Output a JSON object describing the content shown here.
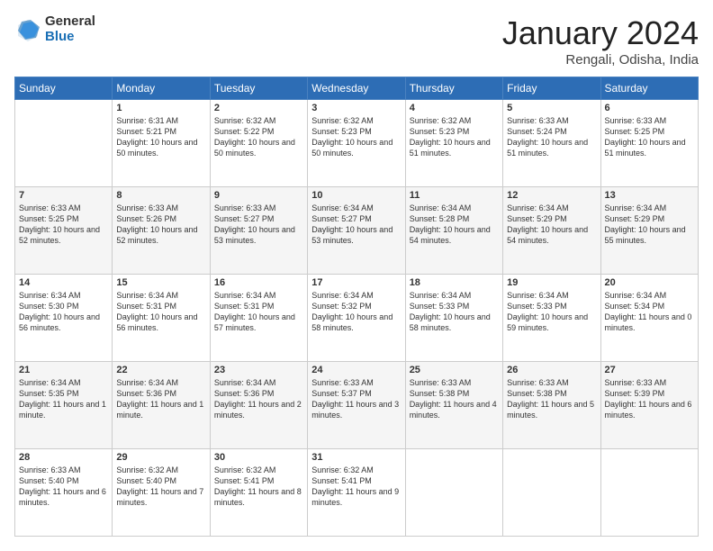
{
  "logo": {
    "general": "General",
    "blue": "Blue"
  },
  "title": "January 2024",
  "subtitle": "Rengali, Odisha, India",
  "weekdays": [
    "Sunday",
    "Monday",
    "Tuesday",
    "Wednesday",
    "Thursday",
    "Friday",
    "Saturday"
  ],
  "weeks": [
    [
      {
        "day": "",
        "sunrise": "",
        "sunset": "",
        "daylight": ""
      },
      {
        "day": "1",
        "sunrise": "Sunrise: 6:31 AM",
        "sunset": "Sunset: 5:21 PM",
        "daylight": "Daylight: 10 hours and 50 minutes."
      },
      {
        "day": "2",
        "sunrise": "Sunrise: 6:32 AM",
        "sunset": "Sunset: 5:22 PM",
        "daylight": "Daylight: 10 hours and 50 minutes."
      },
      {
        "day": "3",
        "sunrise": "Sunrise: 6:32 AM",
        "sunset": "Sunset: 5:23 PM",
        "daylight": "Daylight: 10 hours and 50 minutes."
      },
      {
        "day": "4",
        "sunrise": "Sunrise: 6:32 AM",
        "sunset": "Sunset: 5:23 PM",
        "daylight": "Daylight: 10 hours and 51 minutes."
      },
      {
        "day": "5",
        "sunrise": "Sunrise: 6:33 AM",
        "sunset": "Sunset: 5:24 PM",
        "daylight": "Daylight: 10 hours and 51 minutes."
      },
      {
        "day": "6",
        "sunrise": "Sunrise: 6:33 AM",
        "sunset": "Sunset: 5:25 PM",
        "daylight": "Daylight: 10 hours and 51 minutes."
      }
    ],
    [
      {
        "day": "7",
        "sunrise": "Sunrise: 6:33 AM",
        "sunset": "Sunset: 5:25 PM",
        "daylight": "Daylight: 10 hours and 52 minutes."
      },
      {
        "day": "8",
        "sunrise": "Sunrise: 6:33 AM",
        "sunset": "Sunset: 5:26 PM",
        "daylight": "Daylight: 10 hours and 52 minutes."
      },
      {
        "day": "9",
        "sunrise": "Sunrise: 6:33 AM",
        "sunset": "Sunset: 5:27 PM",
        "daylight": "Daylight: 10 hours and 53 minutes."
      },
      {
        "day": "10",
        "sunrise": "Sunrise: 6:34 AM",
        "sunset": "Sunset: 5:27 PM",
        "daylight": "Daylight: 10 hours and 53 minutes."
      },
      {
        "day": "11",
        "sunrise": "Sunrise: 6:34 AM",
        "sunset": "Sunset: 5:28 PM",
        "daylight": "Daylight: 10 hours and 54 minutes."
      },
      {
        "day": "12",
        "sunrise": "Sunrise: 6:34 AM",
        "sunset": "Sunset: 5:29 PM",
        "daylight": "Daylight: 10 hours and 54 minutes."
      },
      {
        "day": "13",
        "sunrise": "Sunrise: 6:34 AM",
        "sunset": "Sunset: 5:29 PM",
        "daylight": "Daylight: 10 hours and 55 minutes."
      }
    ],
    [
      {
        "day": "14",
        "sunrise": "Sunrise: 6:34 AM",
        "sunset": "Sunset: 5:30 PM",
        "daylight": "Daylight: 10 hours and 56 minutes."
      },
      {
        "day": "15",
        "sunrise": "Sunrise: 6:34 AM",
        "sunset": "Sunset: 5:31 PM",
        "daylight": "Daylight: 10 hours and 56 minutes."
      },
      {
        "day": "16",
        "sunrise": "Sunrise: 6:34 AM",
        "sunset": "Sunset: 5:31 PM",
        "daylight": "Daylight: 10 hours and 57 minutes."
      },
      {
        "day": "17",
        "sunrise": "Sunrise: 6:34 AM",
        "sunset": "Sunset: 5:32 PM",
        "daylight": "Daylight: 10 hours and 58 minutes."
      },
      {
        "day": "18",
        "sunrise": "Sunrise: 6:34 AM",
        "sunset": "Sunset: 5:33 PM",
        "daylight": "Daylight: 10 hours and 58 minutes."
      },
      {
        "day": "19",
        "sunrise": "Sunrise: 6:34 AM",
        "sunset": "Sunset: 5:33 PM",
        "daylight": "Daylight: 10 hours and 59 minutes."
      },
      {
        "day": "20",
        "sunrise": "Sunrise: 6:34 AM",
        "sunset": "Sunset: 5:34 PM",
        "daylight": "Daylight: 11 hours and 0 minutes."
      }
    ],
    [
      {
        "day": "21",
        "sunrise": "Sunrise: 6:34 AM",
        "sunset": "Sunset: 5:35 PM",
        "daylight": "Daylight: 11 hours and 1 minute."
      },
      {
        "day": "22",
        "sunrise": "Sunrise: 6:34 AM",
        "sunset": "Sunset: 5:36 PM",
        "daylight": "Daylight: 11 hours and 1 minute."
      },
      {
        "day": "23",
        "sunrise": "Sunrise: 6:34 AM",
        "sunset": "Sunset: 5:36 PM",
        "daylight": "Daylight: 11 hours and 2 minutes."
      },
      {
        "day": "24",
        "sunrise": "Sunrise: 6:33 AM",
        "sunset": "Sunset: 5:37 PM",
        "daylight": "Daylight: 11 hours and 3 minutes."
      },
      {
        "day": "25",
        "sunrise": "Sunrise: 6:33 AM",
        "sunset": "Sunset: 5:38 PM",
        "daylight": "Daylight: 11 hours and 4 minutes."
      },
      {
        "day": "26",
        "sunrise": "Sunrise: 6:33 AM",
        "sunset": "Sunset: 5:38 PM",
        "daylight": "Daylight: 11 hours and 5 minutes."
      },
      {
        "day": "27",
        "sunrise": "Sunrise: 6:33 AM",
        "sunset": "Sunset: 5:39 PM",
        "daylight": "Daylight: 11 hours and 6 minutes."
      }
    ],
    [
      {
        "day": "28",
        "sunrise": "Sunrise: 6:33 AM",
        "sunset": "Sunset: 5:40 PM",
        "daylight": "Daylight: 11 hours and 6 minutes."
      },
      {
        "day": "29",
        "sunrise": "Sunrise: 6:32 AM",
        "sunset": "Sunset: 5:40 PM",
        "daylight": "Daylight: 11 hours and 7 minutes."
      },
      {
        "day": "30",
        "sunrise": "Sunrise: 6:32 AM",
        "sunset": "Sunset: 5:41 PM",
        "daylight": "Daylight: 11 hours and 8 minutes."
      },
      {
        "day": "31",
        "sunrise": "Sunrise: 6:32 AM",
        "sunset": "Sunset: 5:41 PM",
        "daylight": "Daylight: 11 hours and 9 minutes."
      },
      {
        "day": "",
        "sunrise": "",
        "sunset": "",
        "daylight": ""
      },
      {
        "day": "",
        "sunrise": "",
        "sunset": "",
        "daylight": ""
      },
      {
        "day": "",
        "sunrise": "",
        "sunset": "",
        "daylight": ""
      }
    ]
  ]
}
